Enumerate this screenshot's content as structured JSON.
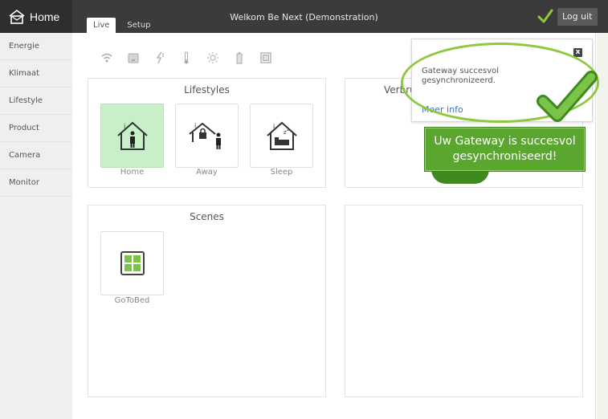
{
  "header": {
    "logo_text": "Home",
    "welcome": "Welkom Be Next (Demonstration)",
    "logout_label": "Log uit",
    "tabs": [
      {
        "label": "Live"
      },
      {
        "label": "Setup"
      }
    ]
  },
  "sidebar": {
    "items": [
      {
        "label": "Energie"
      },
      {
        "label": "Klimaat"
      },
      {
        "label": "Lifestyle"
      },
      {
        "label": "Product"
      },
      {
        "label": "Camera"
      },
      {
        "label": "Monitor"
      }
    ]
  },
  "device_icons": [
    "wifi-icon",
    "gateway-icon",
    "plug-icon",
    "thermometer-icon",
    "sun-icon",
    "battery-icon",
    "panel-icon"
  ],
  "lifestyles": {
    "title": "Lifestyles",
    "items": [
      {
        "label": "Home",
        "icon": "home-person-icon",
        "active": true
      },
      {
        "label": "Away",
        "icon": "away-lock-icon",
        "active": false
      },
      {
        "label": "Sleep",
        "icon": "sleep-bed-icon",
        "active": false
      }
    ]
  },
  "verbruik": {
    "title": "Verbruik"
  },
  "scenes": {
    "title": "Scenes",
    "items": [
      {
        "label": "GoToBed",
        "icon": "grid-icon"
      }
    ]
  },
  "notification": {
    "message": "Gateway succesvol gesynchronizeerd.",
    "link": "Meer info"
  },
  "callout": {
    "line1": "Uw Gateway is succesvol",
    "line2": "gesynchroniseerd!"
  },
  "colors": {
    "topbar": "#3b3b3b",
    "accent_green": "#5aa62f",
    "active_tile": "#c8f0c8",
    "link_blue": "#3d72b8"
  }
}
